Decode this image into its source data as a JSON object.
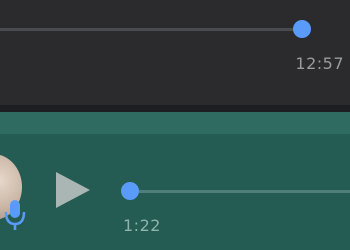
{
  "incoming_voice": {
    "duration": "12:57",
    "progress": 1.0
  },
  "outgoing_voice": {
    "duration": "1:22",
    "progress": 0.0,
    "play_icon": "play-icon",
    "mic_icon": "microphone-icon"
  },
  "colors": {
    "accent": "#5a9bfa",
    "incoming_bubble": "#2b2b2e",
    "outgoing_bubble": "#245b52",
    "background": "#1d1e22"
  }
}
